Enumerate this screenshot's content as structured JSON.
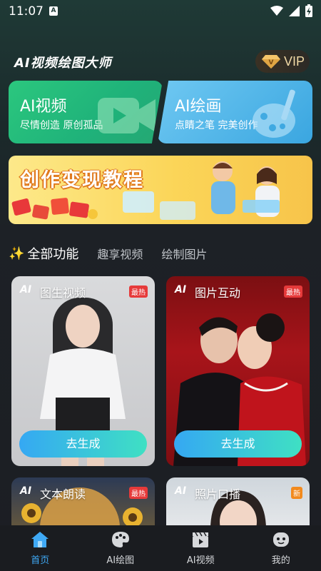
{
  "status_bar": {
    "time": "11:07",
    "notification_badge": "A",
    "icons": [
      "wifi-icon",
      "signal-icon",
      "battery-charging-icon"
    ]
  },
  "header": {
    "app_title": "AI视频绘图大师",
    "vip_label": "VIP"
  },
  "features": [
    {
      "title": "AI视频",
      "subtitle": "尽情创造 原创孤品",
      "icon": "video-camera-icon"
    },
    {
      "title": "AI绘画",
      "subtitle": "点睛之笔 完美创作",
      "icon": "palette-brush-icon"
    }
  ],
  "banner": {
    "title": "创作变现教程"
  },
  "tabs": [
    {
      "label": "全部功能",
      "active": true,
      "icon": "sparkle-icon"
    },
    {
      "label": "趣享视频",
      "active": false
    },
    {
      "label": "绘制图片",
      "active": false
    }
  ],
  "cards": [
    {
      "ai_mark": "AI",
      "title": "图生视频",
      "badge": "最热",
      "button": "去生成"
    },
    {
      "ai_mark": "AI",
      "title": "图片互动",
      "badge": "最热",
      "button": "去生成"
    },
    {
      "ai_mark": "AI",
      "title": "文本朗读",
      "badge": "最热"
    },
    {
      "ai_mark": "AI",
      "title": "照片口播",
      "badge": "新"
    }
  ],
  "nav": [
    {
      "label": "首页",
      "active": true,
      "icon": "home-icon"
    },
    {
      "label": "AI绘图",
      "active": false,
      "icon": "palette-icon"
    },
    {
      "label": "AI视频",
      "active": false,
      "icon": "clapperboard-icon"
    },
    {
      "label": "我的",
      "active": false,
      "icon": "profile-icon"
    }
  ],
  "colors": {
    "accent_blue": "#3fa9f5",
    "video_green": "#2bc77e",
    "paint_blue": "#3aa6e0",
    "banner_yellow": "#fbd558",
    "hot_red": "#e63a3a",
    "new_orange": "#f28a1e"
  }
}
